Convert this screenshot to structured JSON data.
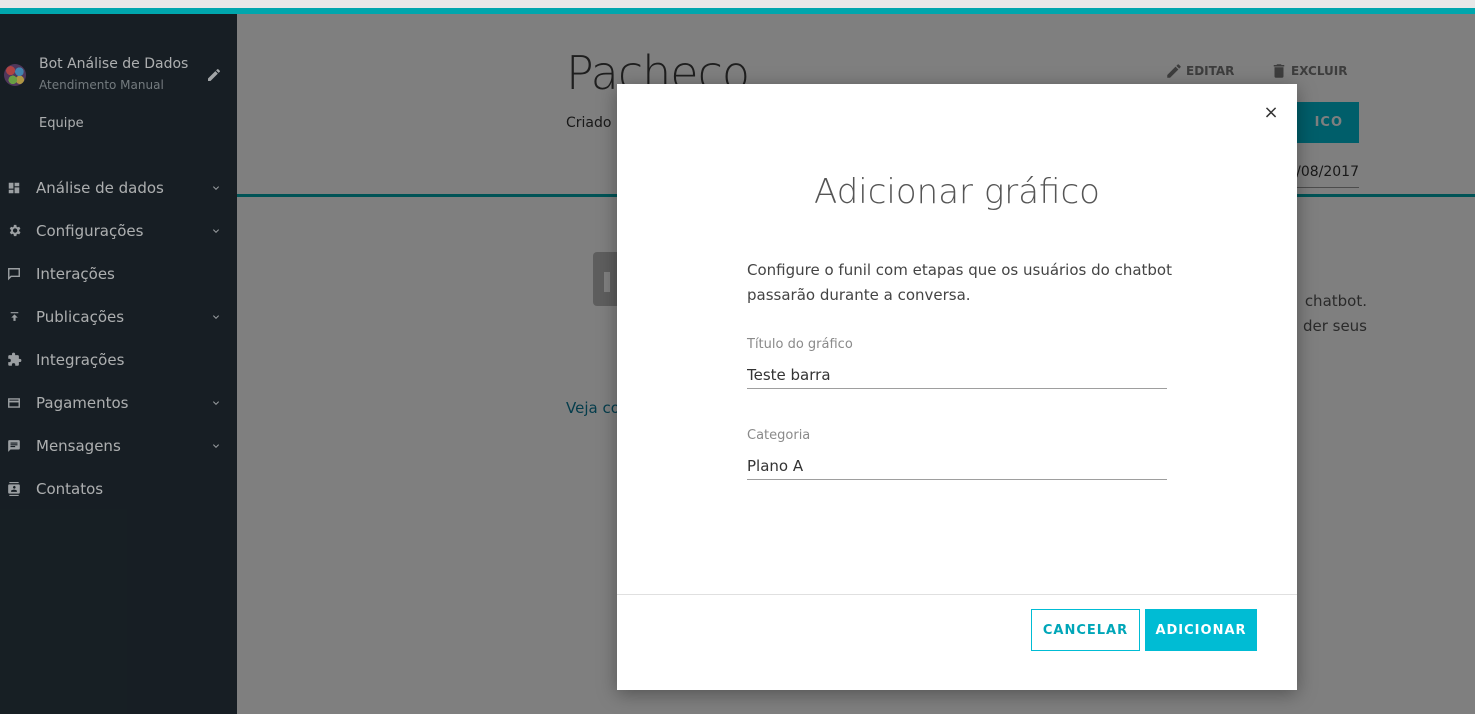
{
  "sidebar": {
    "bot_name": "Bot Análise de Dados",
    "bot_subtitle": "Atendimento Manual",
    "team_label": "Equipe",
    "items": [
      {
        "label": "Análise de dados",
        "icon": "dashboard-icon",
        "has_submenu": true
      },
      {
        "label": "Configurações",
        "icon": "gear-icon",
        "has_submenu": true
      },
      {
        "label": "Interações",
        "icon": "chat-bubble-icon",
        "has_submenu": false
      },
      {
        "label": "Publicações",
        "icon": "upload-icon",
        "has_submenu": true
      },
      {
        "label": "Integrações",
        "icon": "puzzle-icon",
        "has_submenu": false
      },
      {
        "label": "Pagamentos",
        "icon": "credit-card-icon",
        "has_submenu": true
      },
      {
        "label": "Mensagens",
        "icon": "message-icon",
        "has_submenu": true
      },
      {
        "label": "Contatos",
        "icon": "contacts-icon",
        "has_submenu": false
      }
    ]
  },
  "page": {
    "title": "Pacheco",
    "created_text": "Criado",
    "edit_label": "EDITAR",
    "delete_label": "EXCLUIR",
    "add_chart_button_partial": "ICO",
    "date_partial": "/08/2017",
    "info_partial_line1": "chatbot.",
    "info_partial_line2": "der seus",
    "link_partial": "Veja co"
  },
  "modal": {
    "title": "Adicionar gráfico",
    "description": "Configure o funil com etapas que os usuários do chatbot passarão durante a conversa.",
    "fields": {
      "chart_title": {
        "label": "Título do gráfico",
        "value": "Teste barra"
      },
      "category": {
        "label": "Categoria",
        "value": "Plano A"
      }
    },
    "cancel_label": "CANCELAR",
    "submit_label": "ADICIONAR",
    "close_glyph": "×"
  },
  "colors": {
    "accent": "#00bcd4",
    "teal_bar": "#00a6ad",
    "sidebar_bg": "#1f2930"
  }
}
